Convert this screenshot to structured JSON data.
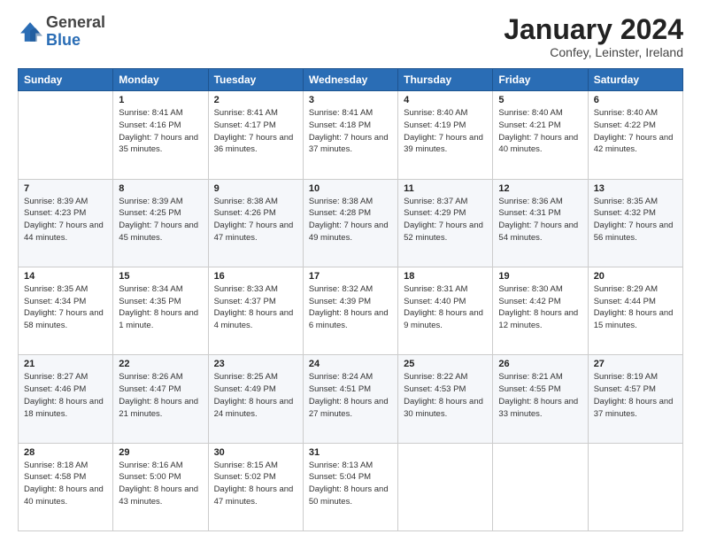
{
  "header": {
    "logo_general": "General",
    "logo_blue": "Blue",
    "month_title": "January 2024",
    "location": "Confey, Leinster, Ireland"
  },
  "weekdays": [
    "Sunday",
    "Monday",
    "Tuesday",
    "Wednesday",
    "Thursday",
    "Friday",
    "Saturday"
  ],
  "weeks": [
    [
      {
        "day": "",
        "sunrise": "",
        "sunset": "",
        "daylight": ""
      },
      {
        "day": "1",
        "sunrise": "Sunrise: 8:41 AM",
        "sunset": "Sunset: 4:16 PM",
        "daylight": "Daylight: 7 hours and 35 minutes."
      },
      {
        "day": "2",
        "sunrise": "Sunrise: 8:41 AM",
        "sunset": "Sunset: 4:17 PM",
        "daylight": "Daylight: 7 hours and 36 minutes."
      },
      {
        "day": "3",
        "sunrise": "Sunrise: 8:41 AM",
        "sunset": "Sunset: 4:18 PM",
        "daylight": "Daylight: 7 hours and 37 minutes."
      },
      {
        "day": "4",
        "sunrise": "Sunrise: 8:40 AM",
        "sunset": "Sunset: 4:19 PM",
        "daylight": "Daylight: 7 hours and 39 minutes."
      },
      {
        "day": "5",
        "sunrise": "Sunrise: 8:40 AM",
        "sunset": "Sunset: 4:21 PM",
        "daylight": "Daylight: 7 hours and 40 minutes."
      },
      {
        "day": "6",
        "sunrise": "Sunrise: 8:40 AM",
        "sunset": "Sunset: 4:22 PM",
        "daylight": "Daylight: 7 hours and 42 minutes."
      }
    ],
    [
      {
        "day": "7",
        "sunrise": "Sunrise: 8:39 AM",
        "sunset": "Sunset: 4:23 PM",
        "daylight": "Daylight: 7 hours and 44 minutes."
      },
      {
        "day": "8",
        "sunrise": "Sunrise: 8:39 AM",
        "sunset": "Sunset: 4:25 PM",
        "daylight": "Daylight: 7 hours and 45 minutes."
      },
      {
        "day": "9",
        "sunrise": "Sunrise: 8:38 AM",
        "sunset": "Sunset: 4:26 PM",
        "daylight": "Daylight: 7 hours and 47 minutes."
      },
      {
        "day": "10",
        "sunrise": "Sunrise: 8:38 AM",
        "sunset": "Sunset: 4:28 PM",
        "daylight": "Daylight: 7 hours and 49 minutes."
      },
      {
        "day": "11",
        "sunrise": "Sunrise: 8:37 AM",
        "sunset": "Sunset: 4:29 PM",
        "daylight": "Daylight: 7 hours and 52 minutes."
      },
      {
        "day": "12",
        "sunrise": "Sunrise: 8:36 AM",
        "sunset": "Sunset: 4:31 PM",
        "daylight": "Daylight: 7 hours and 54 minutes."
      },
      {
        "day": "13",
        "sunrise": "Sunrise: 8:35 AM",
        "sunset": "Sunset: 4:32 PM",
        "daylight": "Daylight: 7 hours and 56 minutes."
      }
    ],
    [
      {
        "day": "14",
        "sunrise": "Sunrise: 8:35 AM",
        "sunset": "Sunset: 4:34 PM",
        "daylight": "Daylight: 7 hours and 58 minutes."
      },
      {
        "day": "15",
        "sunrise": "Sunrise: 8:34 AM",
        "sunset": "Sunset: 4:35 PM",
        "daylight": "Daylight: 8 hours and 1 minute."
      },
      {
        "day": "16",
        "sunrise": "Sunrise: 8:33 AM",
        "sunset": "Sunset: 4:37 PM",
        "daylight": "Daylight: 8 hours and 4 minutes."
      },
      {
        "day": "17",
        "sunrise": "Sunrise: 8:32 AM",
        "sunset": "Sunset: 4:39 PM",
        "daylight": "Daylight: 8 hours and 6 minutes."
      },
      {
        "day": "18",
        "sunrise": "Sunrise: 8:31 AM",
        "sunset": "Sunset: 4:40 PM",
        "daylight": "Daylight: 8 hours and 9 minutes."
      },
      {
        "day": "19",
        "sunrise": "Sunrise: 8:30 AM",
        "sunset": "Sunset: 4:42 PM",
        "daylight": "Daylight: 8 hours and 12 minutes."
      },
      {
        "day": "20",
        "sunrise": "Sunrise: 8:29 AM",
        "sunset": "Sunset: 4:44 PM",
        "daylight": "Daylight: 8 hours and 15 minutes."
      }
    ],
    [
      {
        "day": "21",
        "sunrise": "Sunrise: 8:27 AM",
        "sunset": "Sunset: 4:46 PM",
        "daylight": "Daylight: 8 hours and 18 minutes."
      },
      {
        "day": "22",
        "sunrise": "Sunrise: 8:26 AM",
        "sunset": "Sunset: 4:47 PM",
        "daylight": "Daylight: 8 hours and 21 minutes."
      },
      {
        "day": "23",
        "sunrise": "Sunrise: 8:25 AM",
        "sunset": "Sunset: 4:49 PM",
        "daylight": "Daylight: 8 hours and 24 minutes."
      },
      {
        "day": "24",
        "sunrise": "Sunrise: 8:24 AM",
        "sunset": "Sunset: 4:51 PM",
        "daylight": "Daylight: 8 hours and 27 minutes."
      },
      {
        "day": "25",
        "sunrise": "Sunrise: 8:22 AM",
        "sunset": "Sunset: 4:53 PM",
        "daylight": "Daylight: 8 hours and 30 minutes."
      },
      {
        "day": "26",
        "sunrise": "Sunrise: 8:21 AM",
        "sunset": "Sunset: 4:55 PM",
        "daylight": "Daylight: 8 hours and 33 minutes."
      },
      {
        "day": "27",
        "sunrise": "Sunrise: 8:19 AM",
        "sunset": "Sunset: 4:57 PM",
        "daylight": "Daylight: 8 hours and 37 minutes."
      }
    ],
    [
      {
        "day": "28",
        "sunrise": "Sunrise: 8:18 AM",
        "sunset": "Sunset: 4:58 PM",
        "daylight": "Daylight: 8 hours and 40 minutes."
      },
      {
        "day": "29",
        "sunrise": "Sunrise: 8:16 AM",
        "sunset": "Sunset: 5:00 PM",
        "daylight": "Daylight: 8 hours and 43 minutes."
      },
      {
        "day": "30",
        "sunrise": "Sunrise: 8:15 AM",
        "sunset": "Sunset: 5:02 PM",
        "daylight": "Daylight: 8 hours and 47 minutes."
      },
      {
        "day": "31",
        "sunrise": "Sunrise: 8:13 AM",
        "sunset": "Sunset: 5:04 PM",
        "daylight": "Daylight: 8 hours and 50 minutes."
      },
      {
        "day": "",
        "sunrise": "",
        "sunset": "",
        "daylight": ""
      },
      {
        "day": "",
        "sunrise": "",
        "sunset": "",
        "daylight": ""
      },
      {
        "day": "",
        "sunrise": "",
        "sunset": "",
        "daylight": ""
      }
    ]
  ]
}
